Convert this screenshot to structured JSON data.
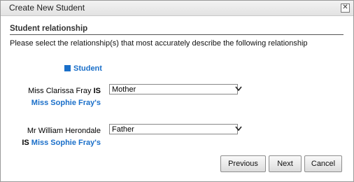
{
  "window": {
    "title": "Create New Student"
  },
  "section": {
    "title": "Student relationship"
  },
  "instructions": "Please select the relationship(s) that most accurately describe the following relationship",
  "student_link": "Student",
  "rows": [
    {
      "person": "Miss Clarissa Fray",
      "is": "IS",
      "target": "Miss Sophie Fray's",
      "selected": "Mother"
    },
    {
      "person": "Mr William Herondale",
      "is": "IS",
      "target": "Miss Sophie Fray's",
      "selected": "Father"
    }
  ],
  "buttons": {
    "previous": "Previous",
    "next": "Next",
    "cancel": "Cancel"
  },
  "colors": {
    "link": "#1a6fc9"
  }
}
